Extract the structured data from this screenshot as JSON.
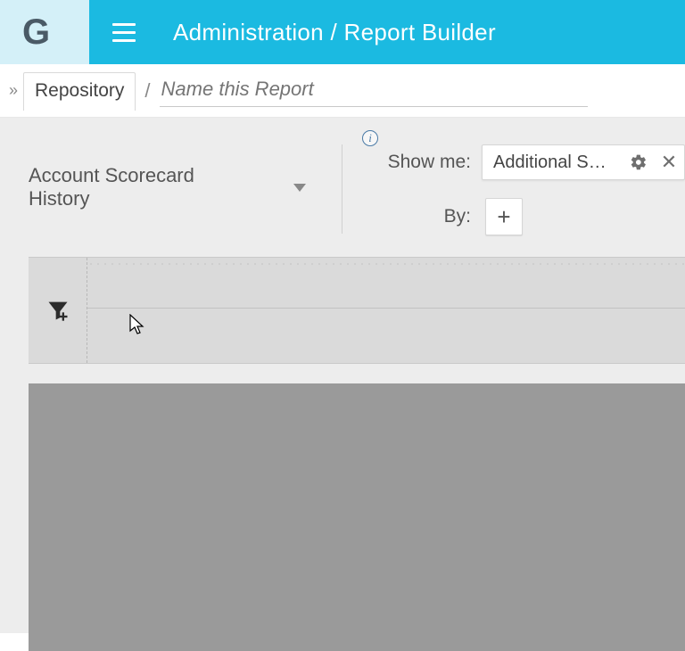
{
  "header": {
    "logo_letter": "G",
    "breadcrumb": "Administration / Report Builder"
  },
  "subheader": {
    "repo_label": "Repository",
    "name_placeholder": "Name this Report"
  },
  "config": {
    "object_name": "Account Scorecard History",
    "show_me_label": "Show me:",
    "by_label": "By:",
    "selected_field": "Additional Scor…"
  }
}
